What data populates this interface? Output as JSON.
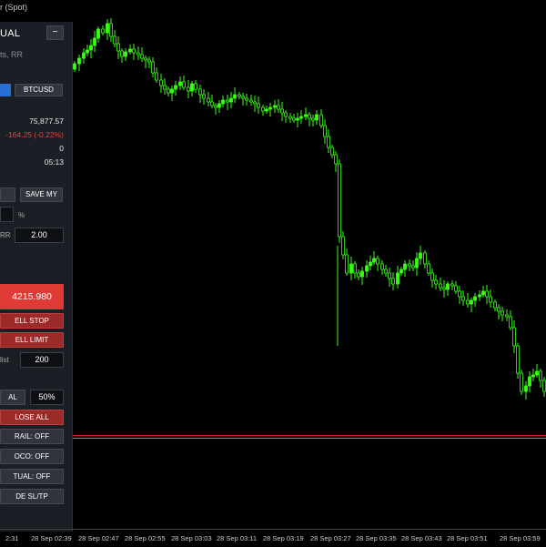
{
  "window_title": "r (Spot)",
  "panel": {
    "title": "UAL",
    "minimize_label": "−",
    "subtitle": "ts, RR",
    "symbol_button": "BTCUSD",
    "price": "75,877.57",
    "change": "-164.25 (-0.22%)",
    "zero_value": "0",
    "time": "05:13",
    "save_button": "SAVE MY",
    "percent_label": "%",
    "rr_label": "RR",
    "rr_value": "2.00",
    "sell_price": "4215.980",
    "sell_stop": "ELL STOP",
    "sell_limit": "ELL LIMIT",
    "dist_label": "list",
    "dist_value": "200",
    "partial_label": "AL",
    "partial_value": "50%",
    "close_all": "LOSE ALL",
    "trail": "RAIL: OFF",
    "oco": "OCO: OFF",
    "virtual": "TUAL: OFF",
    "hide_sltp": "DE SL/TP"
  },
  "colors": {
    "bull": "#39ff14",
    "bear": "#000000",
    "wick": "#39ff14",
    "hline_red": "#d02020",
    "hline_grey": "#888888"
  },
  "x_axis_labels": [
    "2:31",
    "28 Sep 02:39",
    "28 Sep 02:47",
    "28 Sep 02:55",
    "28 Sep 03:03",
    "28 Sep 03:11",
    "28 Sep 03:19",
    "28 Sep 03:27",
    "28 Sep 03:35",
    "28 Sep 03:43",
    "28 Sep 03:51",
    "28 Sep 03:59"
  ]
}
